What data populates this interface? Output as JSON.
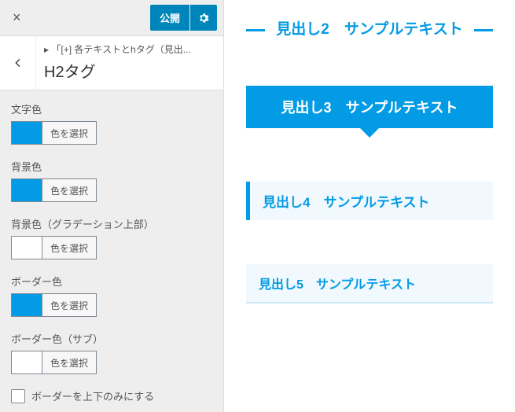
{
  "topbar": {
    "publish": "公開",
    "close": "×"
  },
  "breadcrumb": {
    "path": "「[+] 各テキストとhタグ（見出...",
    "title": "H2タグ",
    "caret": "▸"
  },
  "controls": {
    "text_color": {
      "label": "文字色",
      "button": "色を選択",
      "swatch": "blue"
    },
    "bg_color": {
      "label": "背景色",
      "button": "色を選択",
      "swatch": "blue"
    },
    "bg_grad_top": {
      "label": "背景色（グラデーション上部）",
      "button": "色を選択",
      "swatch": "white"
    },
    "border_color": {
      "label": "ボーダー色",
      "button": "色を選択",
      "swatch": "blue"
    },
    "border_sub": {
      "label": "ボーダー色（サブ）",
      "button": "色を選択",
      "swatch": "white"
    },
    "border_tb_only": {
      "label": "ボーダーを上下のみにする"
    }
  },
  "preview": {
    "h2": "見出し2　サンプルテキスト",
    "h3": "見出し3　サンプルテキスト",
    "h4": "見出し4　サンプルテキスト",
    "h5": "見出し5　サンプルテキスト"
  }
}
